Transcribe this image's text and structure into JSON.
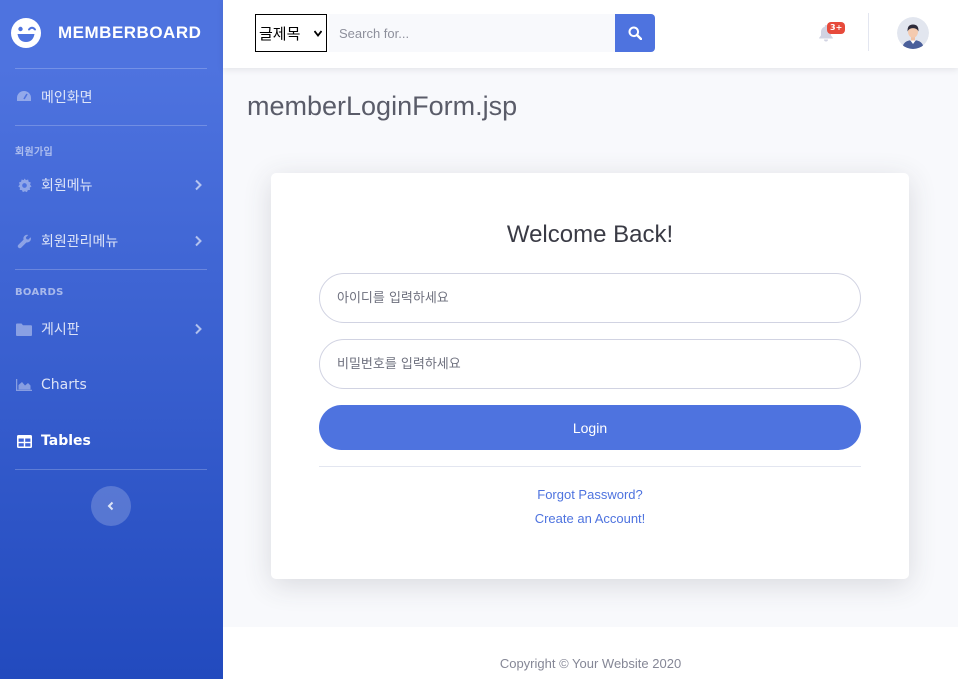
{
  "brand": {
    "name": "MEMBERBOARD",
    "icon": "laugh-wink-icon"
  },
  "sidebar": {
    "dashboard": {
      "label": "메인화면",
      "icon": "tachometer-icon"
    },
    "section_member": "회원가입",
    "member_menu": {
      "label": "회원메뉴",
      "icon": "cog-icon"
    },
    "member_admin_menu": {
      "label": "회원관리메뉴",
      "icon": "wrench-icon"
    },
    "section_boards": "BOARDS",
    "board": {
      "label": "게시판",
      "icon": "folder-icon"
    },
    "charts": {
      "label": "Charts",
      "icon": "chart-area-icon"
    },
    "tables": {
      "label": "Tables",
      "icon": "table-icon"
    },
    "active_item": "Tables"
  },
  "topbar": {
    "category_selected": "글제목",
    "search_placeholder": "Search for...",
    "notification_count": "3+"
  },
  "page": {
    "title": "memberLoginForm.jsp"
  },
  "login": {
    "heading": "Welcome Back!",
    "id_placeholder": "아이디를 입력하세요",
    "password_placeholder": "비밀번호를 입력하세요",
    "login_label": "Login",
    "forgot_password": "Forgot Password?",
    "create_account": "Create an Account!"
  },
  "footer": {
    "copyright": "Copyright © Your Website 2020"
  },
  "colors": {
    "primary": "#4e73df",
    "sidebar_end": "#224abe",
    "danger": "#e74a3b",
    "page_bg": "#f8f9fc"
  }
}
